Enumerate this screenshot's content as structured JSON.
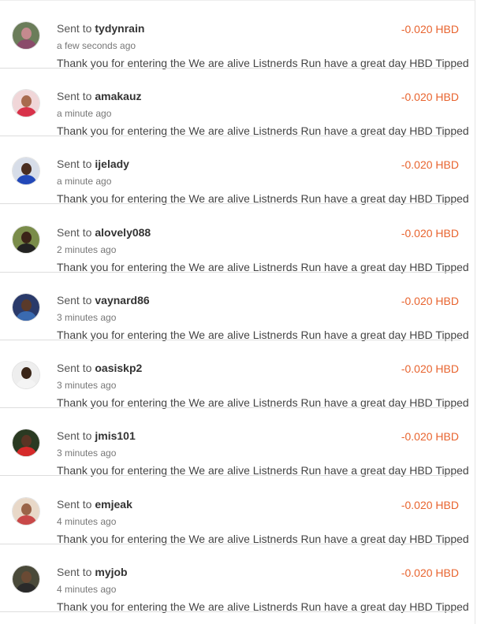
{
  "sent_prefix": "Sent to",
  "transactions": [
    {
      "user": "tydynrain",
      "time": "a few seconds ago",
      "memo": "Thank you for entering the We are alive Listnerds Run have a great day HBD Tipped",
      "amount": "-0.020 HBD",
      "avatar": {
        "bg": "#6b7d5a",
        "skin": "#c48a8e",
        "shirt": "#8a4b6a"
      }
    },
    {
      "user": "amakauz",
      "time": "a minute ago",
      "memo": "Thank you for entering the We are alive Listnerds Run have a great day HBD Tipped",
      "amount": "-0.020 HBD",
      "avatar": {
        "bg": "#f0d6d8",
        "skin": "#a86a4e",
        "shirt": "#d8324a"
      }
    },
    {
      "user": "ijelady",
      "time": "a minute ago",
      "memo": "Thank you for entering the We are alive Listnerds Run have a great day HBD Tipped",
      "amount": "-0.020 HBD",
      "avatar": {
        "bg": "#d7dde8",
        "skin": "#4a2d20",
        "shirt": "#2248b8"
      }
    },
    {
      "user": "alovely088",
      "time": "2 minutes ago",
      "memo": "Thank you for entering the We are alive Listnerds Run have a great day HBD Tipped",
      "amount": "-0.020 HBD",
      "avatar": {
        "bg": "#7a8c4a",
        "skin": "#3b2418",
        "shirt": "#222222"
      }
    },
    {
      "user": "vaynard86",
      "time": "3 minutes ago",
      "memo": "Thank you for entering the We are alive Listnerds Run have a great day HBD Tipped",
      "amount": "-0.020 HBD",
      "avatar": {
        "bg": "#2a3a6a",
        "skin": "#5a3a2a",
        "shirt": "#3a6ab0"
      }
    },
    {
      "user": "oasiskp2",
      "time": "3 minutes ago",
      "memo": "Thank you for entering the We are alive Listnerds Run have a great day HBD Tipped",
      "amount": "-0.020 HBD",
      "avatar": {
        "bg": "#eeeeee",
        "skin": "#3a2618",
        "shirt": "#f4f4f4"
      }
    },
    {
      "user": "jmis101",
      "time": "3 minutes ago",
      "memo": "Thank you for entering the We are alive Listnerds Run have a great day HBD Tipped",
      "amount": "-0.020 HBD",
      "avatar": {
        "bg": "#2a3a22",
        "skin": "#5a3424",
        "shirt": "#d62a2a"
      }
    },
    {
      "user": "emjeak",
      "time": "4 minutes ago",
      "memo": "Thank you for entering the We are alive Listnerds Run have a great day HBD Tipped",
      "amount": "-0.020 HBD",
      "avatar": {
        "bg": "#e8d8c8",
        "skin": "#9a6448",
        "shirt": "#c84848"
      }
    },
    {
      "user": "myjob",
      "time": "4 minutes ago",
      "memo": "Thank you for entering the We are alive Listnerds Run have a great day HBD Tipped",
      "amount": "-0.020 HBD",
      "avatar": {
        "bg": "#4a4a3a",
        "skin": "#6a4a34",
        "shirt": "#2a2a2a"
      }
    }
  ]
}
